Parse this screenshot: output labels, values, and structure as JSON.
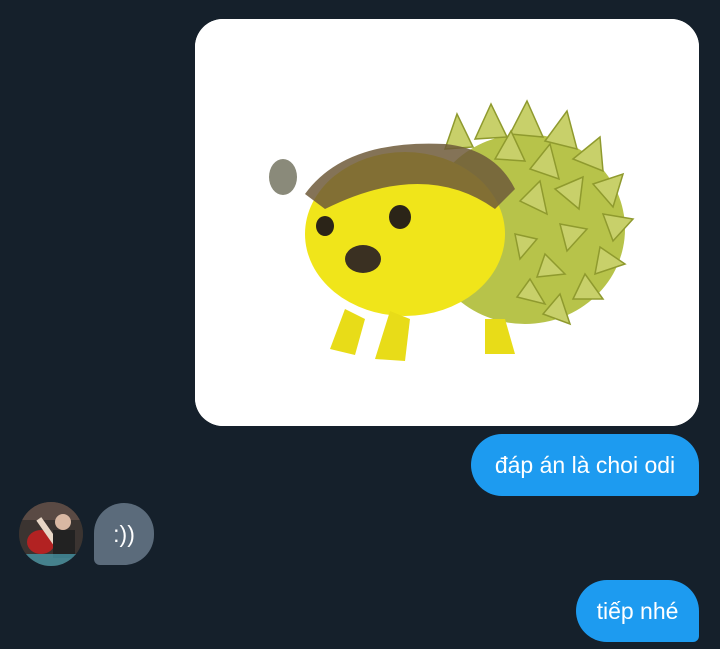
{
  "conversation": {
    "messages": [
      {
        "sender": "me",
        "type": "image",
        "image": "hedgehog-durian-meme"
      },
      {
        "sender": "me",
        "type": "text",
        "text": "đáp án là choi odi"
      },
      {
        "sender": "them",
        "type": "text",
        "text": ":))"
      },
      {
        "sender": "me",
        "type": "text",
        "text": "tiếp nhé"
      }
    ]
  },
  "colors": {
    "background": "#15202b",
    "sent_bubble": "#1d9bf0",
    "received_bubble": "#5b6b7b",
    "text": "#ffffff"
  }
}
